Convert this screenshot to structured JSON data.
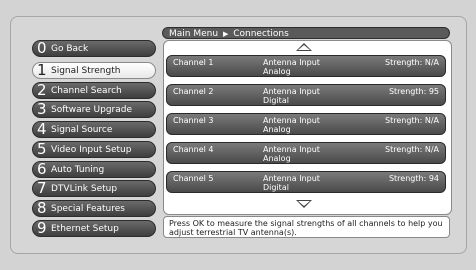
{
  "breadcrumb": {
    "root": "Main Menu",
    "separator": "▶",
    "current": "Connections"
  },
  "menu": [
    {
      "num": "0",
      "label": "Go Back"
    },
    {
      "num": "1",
      "label": "Signal Strength",
      "selected": true
    },
    {
      "num": "2",
      "label": "Channel Search"
    },
    {
      "num": "3",
      "label": "Software Upgrade"
    },
    {
      "num": "4",
      "label": "Signal Source"
    },
    {
      "num": "5",
      "label": "Video Input Setup"
    },
    {
      "num": "6",
      "label": "Auto Tuning"
    },
    {
      "num": "7",
      "label": "DTVLink Setup"
    },
    {
      "num": "8",
      "label": "Special Features"
    },
    {
      "num": "9",
      "label": "Ethernet Setup"
    }
  ],
  "channels": [
    {
      "name": "Channel 1",
      "input": "Antenna Input",
      "type": "Analog",
      "strength": "Strength: N/A"
    },
    {
      "name": "Channel 2",
      "input": "Antenna Input",
      "type": "Digital",
      "strength": "Strength: 95"
    },
    {
      "name": "Channel 3",
      "input": "Antenna Input",
      "type": "Analog",
      "strength": "Strength: N/A"
    },
    {
      "name": "Channel 4",
      "input": "Antenna Input",
      "type": "Analog",
      "strength": "Strength: N/A"
    },
    {
      "name": "Channel 5",
      "input": "Antenna Input",
      "type": "Digital",
      "strength": "Strength: 94"
    }
  ],
  "help_text": "Press OK to measure the signal strengths of all channels to help you adjust terrestrial TV antenna(s).",
  "icons": {
    "scroll_up": "up-arrow-icon",
    "scroll_down": "down-arrow-icon"
  }
}
